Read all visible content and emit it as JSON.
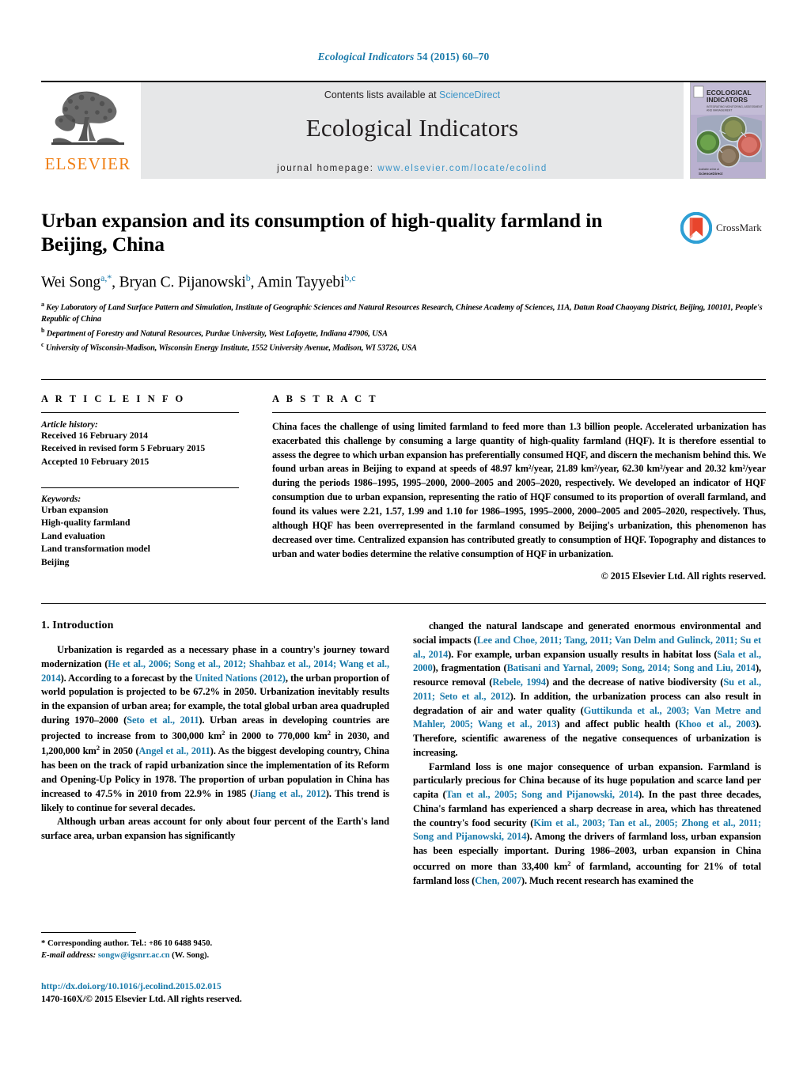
{
  "running_head": {
    "journal_italic": "Ecological Indicators",
    "volume_info": " 54 (2015) 60–70"
  },
  "masthead": {
    "publisher_name": "ELSEVIER",
    "contents_prefix": "Contents lists available at ",
    "contents_link": "ScienceDirect",
    "journal_title": "Ecological Indicators",
    "homepage_prefix": "journal homepage: ",
    "homepage_url": "www.elsevier.com/locate/ecolind",
    "cover_title_line1": "ECOLOGICAL",
    "cover_title_line2": "INDICATORS",
    "cover_subtitle": "INTEGRATING MONITORING, ASSESSMENT AND MANAGEMENT",
    "accent_link_color": "#3a94c8",
    "elsevier_orange": "#F07F13"
  },
  "article": {
    "title": "Urban expansion and its consumption of high-quality farmland in Beijing, China",
    "crossmark_label": "CrossMark",
    "authors_html": "Wei Song<sup>a,*</sup>, Bryan C. Pijanowski<sup>b</sup>, Amin Tayyebi<sup>b,c</sup>",
    "affiliations": [
      "Key Laboratory of Land Surface Pattern and Simulation, Institute of Geographic Sciences and Natural Resources Research, Chinese Academy of Sciences, 11A, Datun Road Chaoyang District, Beijing, 100101, People's Republic of China",
      "Department of Forestry and Natural Resources, Purdue University, West Lafayette, Indiana 47906, USA",
      "University of Wisconsin-Madison, Wisconsin Energy Institute, 1552 University Avenue, Madison, WI 53726, USA"
    ],
    "affiliation_marks": [
      "a",
      "b",
      "c"
    ]
  },
  "article_info": {
    "heading": "A R T I C L E   I N F O",
    "history_label": "Article history:",
    "history": [
      "Received 16 February 2014",
      "Received in revised form 5 February 2015",
      "Accepted 10 February 2015"
    ],
    "keywords_label": "Keywords:",
    "keywords": [
      "Urban expansion",
      "High-quality farmland",
      "Land evaluation",
      "Land transformation model",
      "Beijing"
    ]
  },
  "abstract": {
    "heading": "A B S T R A C T",
    "text": "China faces the challenge of using limited farmland to feed more than 1.3 billion people. Accelerated urbanization has exacerbated this challenge by consuming a large quantity of high-quality farmland (HQF). It is therefore essential to assess the degree to which urban expansion has preferentially consumed HQF, and discern the mechanism behind this. We found urban areas in Beijing to expand at speeds of 48.97 km²/year, 21.89 km²/year, 62.30 km²/year and 20.32 km²/year during the periods 1986–1995, 1995–2000, 2000–2005 and 2005–2020, respectively. We developed an indicator of HQF consumption due to urban expansion, representing the ratio of HQF consumed to its proportion of overall farmland, and found its values were 2.21, 1.57, 1.99 and 1.10 for 1986–1995, 1995–2000, 2000–2005 and 2005–2020, respectively. Thus, although HQF has been overrepresented in the farmland consumed by Beijing's urbanization, this phenomenon has decreased over time. Centralized expansion has contributed greatly to consumption of HQF. Topography and distances to urban and water bodies determine the relative consumption of HQF in urbanization.",
    "copyright": "© 2015 Elsevier Ltd. All rights reserved."
  },
  "body": {
    "section_number_title": "1.  Introduction",
    "left_paragraphs": [
      "Urbanization is regarded as a necessary phase in a country's journey toward modernization (<span class=\"ref\">He et al., 2006; Song et al., 2012; Shahbaz et al., 2014; Wang et al., 2014</span>). According to a forecast by the <span class=\"ref\">United Nations (2012)</span>, the urban proportion of world population is projected to be 67.2% in 2050. Urbanization inevitably results in the expansion of urban area; for example, the total global urban area quadrupled during 1970–2000 (<span class=\"ref\">Seto et al., 2011</span>). Urban areas in developing countries are projected to increase from to 300,000 km<sup class=\"sm\">2</sup> in 2000 to 770,000 km<sup class=\"sm\">2</sup> in 2030, and 1,200,000 km<sup class=\"sm\">2</sup> in 2050 (<span class=\"ref\">Angel et al., 2011</span>). As the biggest developing country, China has been on the track of rapid urbanization since the implementation of its Reform and Opening-Up Policy in 1978. The proportion of urban population in China has increased to 47.5% in 2010 from 22.9% in 1985 (<span class=\"ref\">Jiang et al., 2012</span>). This trend is likely to continue for several decades.",
      "Although urban areas account for only about four percent of the Earth's land surface area, urban expansion has significantly"
    ],
    "right_paragraphs": [
      "changed the natural landscape and generated enormous environmental and social impacts (<span class=\"ref\">Lee and Choe, 2011; Tang, 2011; Van Delm and Gulinck, 2011; Su et al., 2014</span>). For example, urban expansion usually results in habitat loss (<span class=\"ref\">Sala et al., 2000</span>), fragmentation (<span class=\"ref\">Batisani and Yarnal, 2009; Song, 2014; Song and Liu, 2014</span>), resource removal (<span class=\"ref\">Rebele, 1994</span>) and the decrease of native biodiversity (<span class=\"ref\">Su et al., 2011; Seto et al., 2012</span>). In addition, the urbanization process can also result in degradation of air and water quality (<span class=\"ref\">Guttikunda et al., 2003; Van Metre and Mahler, 2005; Wang et al., 2013</span>) and affect public health (<span class=\"ref\">Khoo et al., 2003</span>). Therefore, scientific awareness of the negative consequences of urbanization is increasing.",
      "Farmland loss is one major consequence of urban expansion. Farmland is particularly precious for China because of its huge population and scarce land per capita (<span class=\"ref\">Tan et al., 2005; Song and Pijanowski, 2014</span>). In the past three decades, China's farmland has experienced a sharp decrease in area, which has threatened the country's food security (<span class=\"ref\">Kim et al., 2003; Tan et al., 2005; Zhong et al., 2011; Song and Pijanowski, 2014</span>). Among the drivers of farmland loss, urban expansion has been especially important. During 1986–2003, urban expansion in China occurred on more than 33,400 km<sup class=\"sm\">2</sup> of farmland, accounting for 21% of total farmland loss (<span class=\"ref\">Chen, 2007</span>). Much recent research has examined the"
    ]
  },
  "footnotes": {
    "corresponding": "* Corresponding author. Tel.: +86 10 6488 9450.",
    "email_label": "E-mail address:",
    "email": "songw@igsnrr.ac.cn",
    "email_suffix": " (W. Song)."
  },
  "footer": {
    "doi": "http://dx.doi.org/10.1016/j.ecolind.2015.02.015",
    "issn_line": "1470-160X/© 2015 Elsevier Ltd. All rights reserved."
  }
}
